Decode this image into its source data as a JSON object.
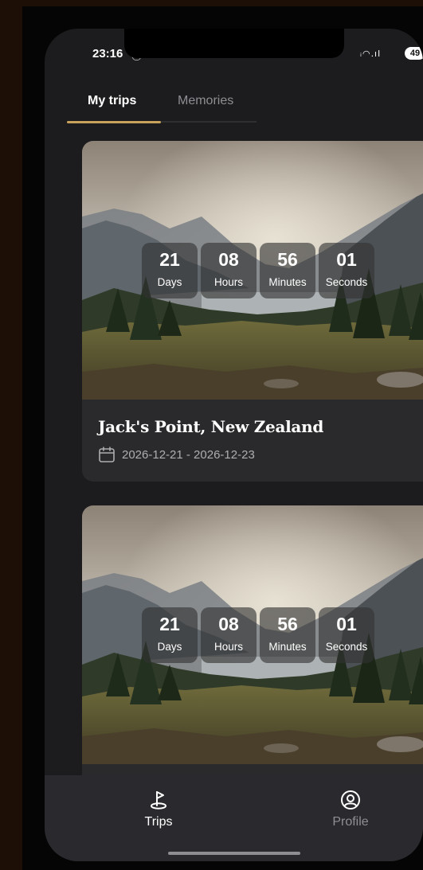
{
  "status_bar": {
    "time": "23:16",
    "battery": "49"
  },
  "tabs": [
    {
      "label": "My trips",
      "active": true
    },
    {
      "label": "Memories",
      "active": false
    }
  ],
  "trips": [
    {
      "countdown": [
        {
          "value": "21",
          "unit": "Days"
        },
        {
          "value": "08",
          "unit": "Hours"
        },
        {
          "value": "56",
          "unit": "Minutes"
        },
        {
          "value": "01",
          "unit": "Seconds"
        }
      ],
      "title": "Jack's Point, New Zealand",
      "dates": "2026-12-21 - 2026-12-23"
    },
    {
      "countdown": [
        {
          "value": "21",
          "unit": "Days"
        },
        {
          "value": "08",
          "unit": "Hours"
        },
        {
          "value": "56",
          "unit": "Minutes"
        },
        {
          "value": "01",
          "unit": "Seconds"
        }
      ]
    }
  ],
  "bottom_nav": [
    {
      "label": "Trips",
      "icon": "golf-flag-icon",
      "active": true
    },
    {
      "label": "Profile",
      "icon": "profile-icon",
      "active": false
    }
  ],
  "colors": {
    "background": "#1e0f06",
    "surface": "#1c1c1e",
    "card": "#2a2a2c",
    "accent": "#c8a25a",
    "text_primary": "#ffffff",
    "text_muted": "#8e8e93"
  }
}
